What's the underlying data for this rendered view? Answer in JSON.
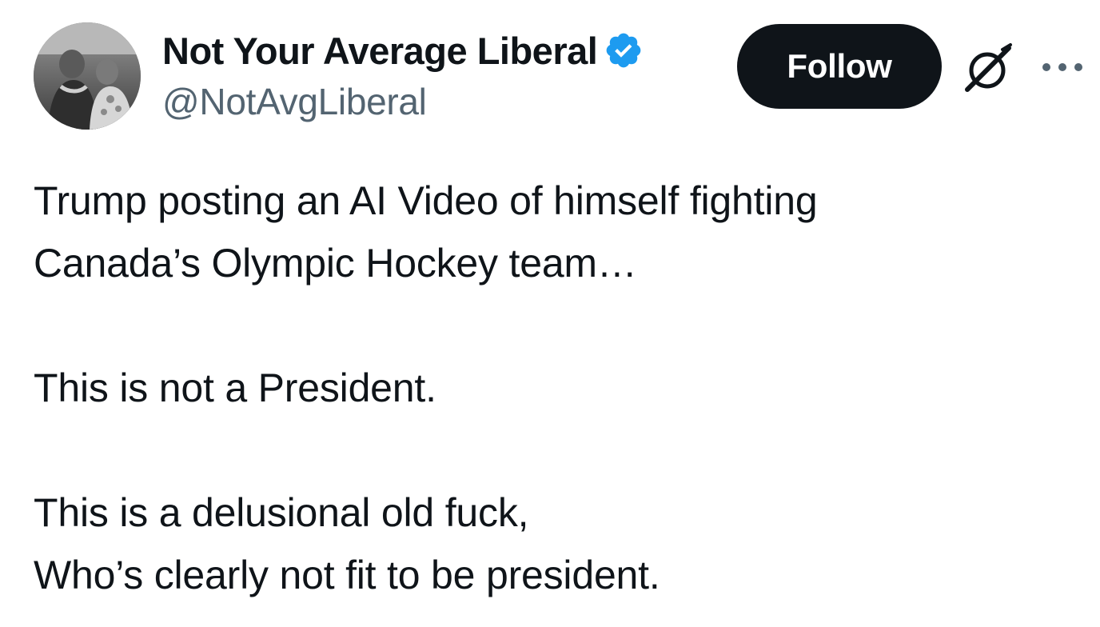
{
  "author": {
    "display_name": "Not Your Average Liberal",
    "handle": "@NotAvgLiberal",
    "verified": true
  },
  "actions": {
    "follow_label": "Follow",
    "grok_icon": "grok-icon",
    "more_icon": "more-options-icon"
  },
  "tweet": {
    "lines": [
      "Trump posting an AI Video of himself fighting",
      "Canada’s Olympic Hockey team…",
      "",
      "This is not a President.",
      "",
      "This is a delusional old fuck,",
      "Who’s clearly not fit to be president."
    ]
  },
  "colors": {
    "text": "#0f1419",
    "secondary_text": "#536471",
    "verified_blue": "#1d9bf0",
    "button_bg": "#0f1419",
    "button_text": "#ffffff"
  }
}
